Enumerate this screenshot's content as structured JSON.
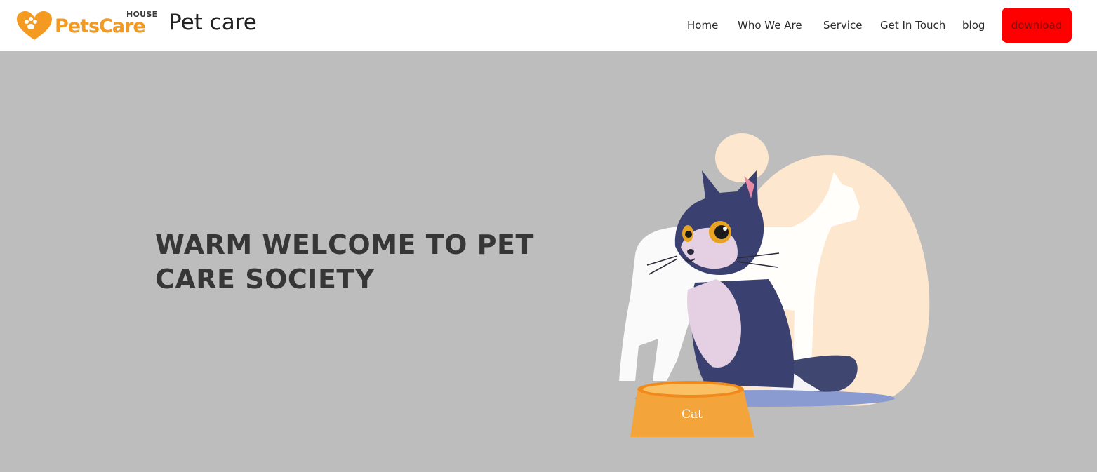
{
  "brand": {
    "logo_word": "PetsCare",
    "logo_tag": "HOUSE",
    "site_title": "Pet care"
  },
  "nav": {
    "items": [
      {
        "label": "Home"
      },
      {
        "label": "Who We Are"
      },
      {
        "label": "Service"
      },
      {
        "label": "Get In Touch"
      },
      {
        "label": "blog"
      }
    ],
    "download_label": "download"
  },
  "hero": {
    "heading": "WARM WELCOME TO PET CARE SOCIETY",
    "bowl_label": "Cat"
  },
  "colors": {
    "brand_orange": "#f59a20",
    "download_bg": "#ff0000",
    "hero_bg": "#bdbdbd",
    "blob": "#fde8cf"
  }
}
